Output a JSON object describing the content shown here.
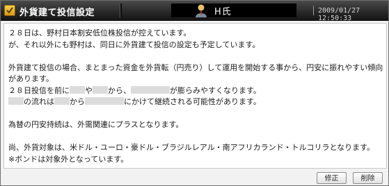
{
  "window": {
    "title": "外貨建て投信設定",
    "user_name": "H氏",
    "timestamp": "2009/01/27 12:50:33"
  },
  "message": {
    "line1": "２８日は、野村日本割安低位株投信が控えています。",
    "line2": "が、それ以外にも野村は、同日に外貨建て投信の設定も予定しています。",
    "line3": "外貨建て投信の場合、まとまった資金を外貨転（円売り）して運用を開始する事から、円安に振れやすい傾向",
    "line4": "があります。",
    "line5a": "２８日投信を前に",
    "line5b": "や",
    "line5c": "から、",
    "line5d": "が膨らみやすくなります。",
    "line6a": "の流れは",
    "line6b": "から",
    "line6c": "にかけて継続される可能性があります。",
    "line7": "為替の円安持続は、外需関連にプラスとなります。",
    "line8": "尚、外貨対象は、米ドル・ユーロ・豪ドル・ブラジルレアル・南アフリカランド・トルコリラとなります。",
    "line9": "※ボンドは対象外となっています。"
  },
  "buttons": {
    "edit": "修正",
    "delete": "削除"
  },
  "colors": {
    "titlebar": "#2a2a2a",
    "icon_accent": "#e8b62a",
    "redaction": "#dcdcdc"
  }
}
